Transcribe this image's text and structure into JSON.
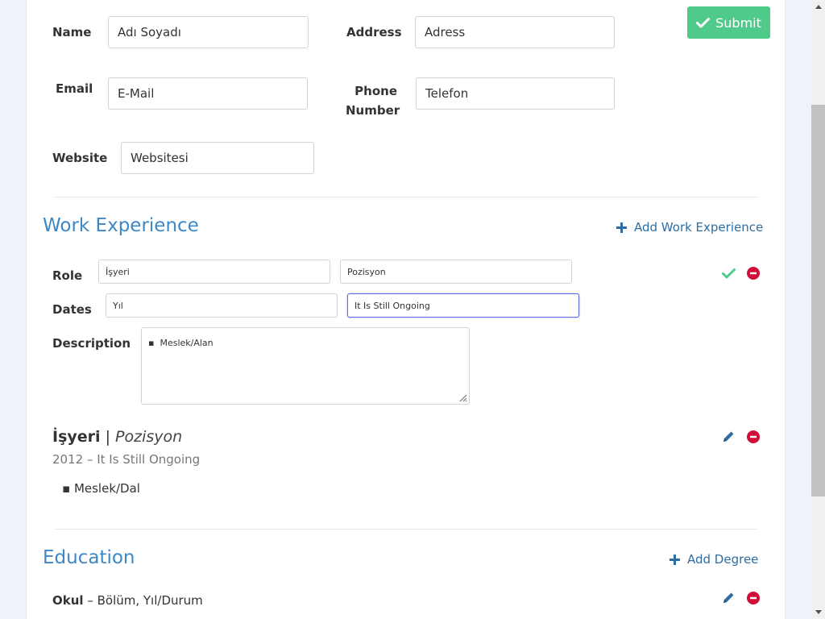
{
  "form": {
    "name_label": "Name",
    "name_value": "Adı Soyadı",
    "address_label": "Address",
    "address_value": "Adress",
    "email_label": "Email",
    "email_value": "E-Mail",
    "phone_label_1": "Phone",
    "phone_label_2": "Number",
    "phone_value": "Telefon",
    "website_label": "Website",
    "website_value": "Websitesi",
    "submit_label": "Submit"
  },
  "work": {
    "title": "Work Experience",
    "add_label": "Add Work Experience",
    "edit": {
      "role_label": "Role",
      "employer_value": "İşyeri",
      "position_value": "Pozisyon",
      "dates_label": "Dates",
      "start_value": "Yıl",
      "end_value": "It Is Still Ongoing",
      "description_label": "Description",
      "description_bullet": "Meslek/Alan"
    },
    "entry": {
      "employer": "İşyeri",
      "separator": " | ",
      "position": "Pozisyon",
      "dates": "2012 – It Is Still Ongoing",
      "bullet": "Meslek/Dal"
    }
  },
  "education": {
    "title": "Education",
    "add_label": "Add Degree",
    "entry": {
      "school": "Okul",
      "details": " – Bölüm, Yıl/Durum"
    }
  },
  "colors": {
    "accent": "#3d87c7",
    "submit": "#4fca8a",
    "remove": "#d0103a",
    "confirm": "#4fca8a"
  },
  "icons": {
    "submit": "check-icon",
    "add": "plus-icon",
    "confirm": "check-icon",
    "remove": "minus-circle-icon",
    "edit": "pencil-icon"
  }
}
